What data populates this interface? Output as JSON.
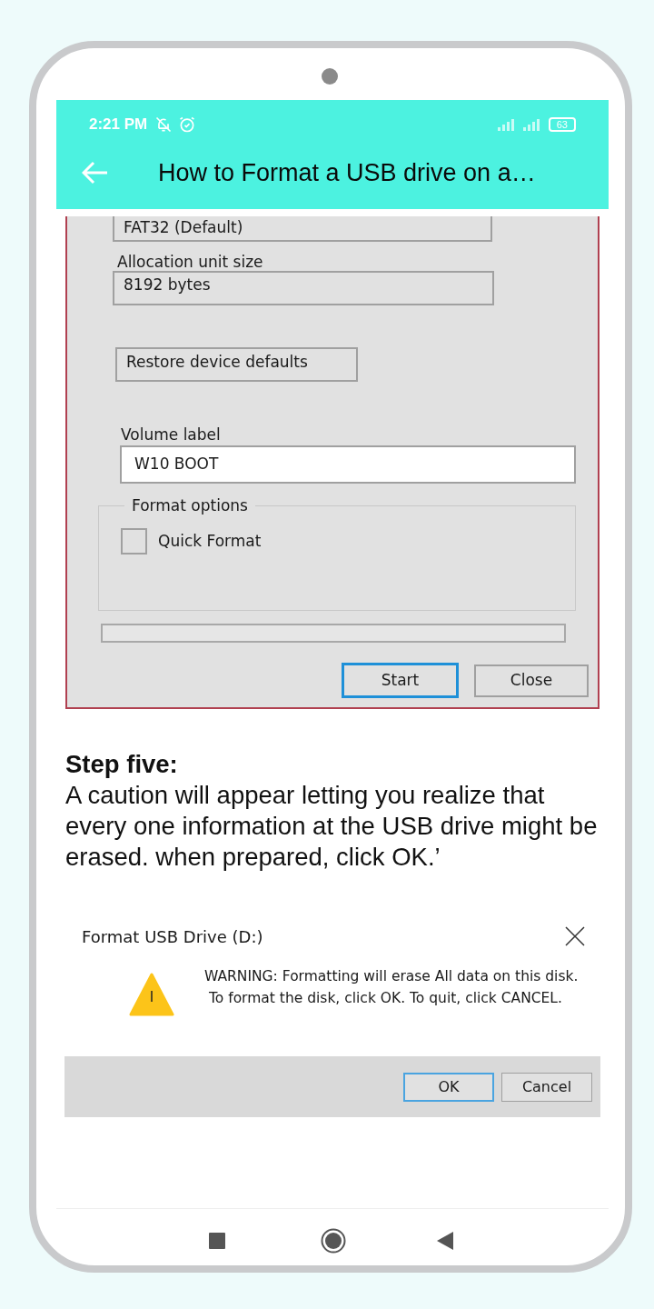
{
  "status_bar": {
    "time": "2:21 PM",
    "battery": "63"
  },
  "app_bar": {
    "title": "How to Format a USB drive on a…"
  },
  "format_dialog": {
    "file_system_value": "FAT32 (Default)",
    "allocation_label": "Allocation unit  size",
    "allocation_value": "8192 bytes",
    "restore_button": "Restore device defaults",
    "volume_label_label": "Volume label",
    "volume_label_value": "W10 BOOT",
    "format_options_legend": "Format options",
    "quick_format": {
      "label": "Quick Format",
      "checked": false
    },
    "buttons": [
      {
        "label": "Start",
        "selected": true
      },
      {
        "label": "Close",
        "selected": false
      }
    ]
  },
  "step": {
    "heading": "Step five:",
    "body": "A caution will appear letting you realize that every one information at the USB drive might be erased. when prepared, click OK.’"
  },
  "warning_dialog": {
    "title": "Format USB Drive (D:)",
    "message": [
      "WARNING: Formatting will erase All data on this disk.",
      " To format the disk, click OK. To quit, click CANCEL."
    ],
    "buttons": [
      {
        "label": "OK",
        "selected": true
      },
      {
        "label": "Cancel",
        "selected": false
      }
    ]
  }
}
